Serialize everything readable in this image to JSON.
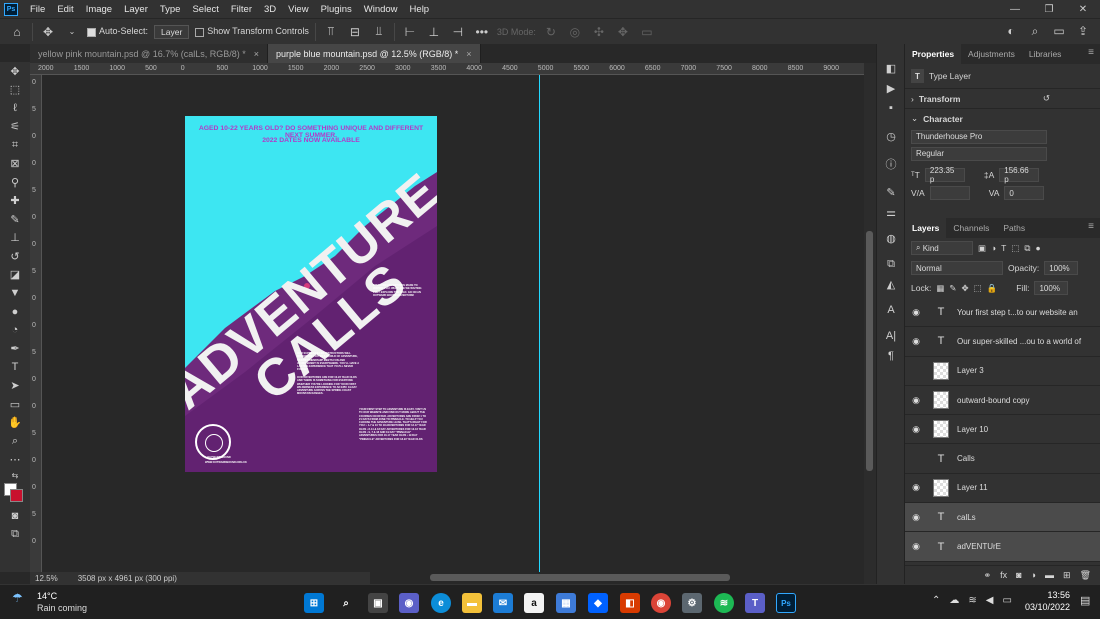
{
  "menubar": {
    "app_icon": "Ps",
    "items": [
      "File",
      "Edit",
      "Image",
      "Layer",
      "Type",
      "Select",
      "Filter",
      "3D",
      "View",
      "Plugins",
      "Window",
      "Help"
    ],
    "window_controls": [
      "—",
      "❐",
      "✕"
    ]
  },
  "options": {
    "auto_select_label": "Auto-Select:",
    "auto_select_value": "Layer",
    "transform_label": "Show Transform Controls",
    "more": "•••",
    "mode_label": "3D Mode:"
  },
  "tabs": [
    {
      "label": "yellow pink mountain.psd @ 16.7% (calLs, RGB/8) *",
      "close": "×"
    },
    {
      "label": "purple blue mountain.psd @ 12.5% (RGB/8) *",
      "close": "×"
    }
  ],
  "ruler": {
    "ticks": [
      "2000",
      "1500",
      "1000",
      "500",
      "0",
      "500",
      "1000",
      "1500",
      "2000",
      "2500",
      "3000",
      "3500",
      "4000",
      "4500",
      "5000",
      "5500",
      "6000",
      "6500",
      "7000",
      "7500",
      "8000",
      "8500",
      "9000"
    ],
    "left_ticks": [
      "0",
      "5",
      "0",
      "0",
      "5",
      "0",
      "0",
      "5",
      "0",
      "0",
      "5",
      "0",
      "0",
      "5",
      "0",
      "0",
      "5",
      "0"
    ]
  },
  "poster": {
    "line1": "AGED 10-22 YEARS OLD? DO SOMETHING UNIQUE AND DIFFERENT NEXT SUMMER.",
    "line2": "2022 DATES NOW AVAILABLE",
    "big1": "ADVENTURE",
    "big2": "CALLS",
    "para1": "DISCOVER ADVENTURES MADE TO INSPIRE YOU. WHAT ARE WE WAITING FOR? EXPLORE THE WILD. GO ON AN OUTWARD BOUND ADVENTURE!",
    "para2": "OUR SUPER-SKILLED INSTRUCTORS WILL INTRODUCE YOU TO A WORLD OF ADVENTURE, WHERE FRIENDSHIP MEETS FUN AND ACHIEVEMENT IS EVERYWHERE. YOU'LL HAVE A LASTING EXPERIENCE THAT YOU'LL NEVER FORGET.",
    "para3": "OUR ADVENTURES ARE FOR 10-22 YEAR OLDS AND THERE IS SOMETHING FOR EVERYONE WHETHER YOU'RE LOOKING FOR YOUR FIRST WILDERNESS EXPERIENCE TO AN EPIC 19-DAY ADVENTURE ACROSS THE SPRING COAST MOUNTAIN RANGES.",
    "para4": "YOUR FIRST STEP TO ADVENTURE IS EASY. VISIT US TO OUR WEBSITE AND FIND OUT MORE ABOUT THE COURSES ON OFFER. ADVENTURES ARE FROM 1 TO 21 DAYS FROM JUNE TO PINNACLE. TO HELP YOU CHOOSE THE ADVENTURE LEVEL THAT'S RIGHT FOR YOU: • 1-7 & 10 TO 18 ADVENTURES FOR 13-17 YEAR OLDS • 8-14 & 18 DAY ADVENTURES FOR 13-16 YEAR OLDS • 9, 7 & 18 AND 19 DAY \"PINNACLE\" ADVENTURES FOR 16-17 YEAR OLDS • 19 DAY \"PINNACLE\" ADVENTURES FOR 18-22 YEAR OLDS",
    "seal_text": "OUTWARD BOUND",
    "website": "WWW.OUTWARDBOUND.ORG.UK"
  },
  "status": {
    "zoom": "12.5%",
    "doc": "3508 px x 4961 px (300 ppi)"
  },
  "properties": {
    "tabs": [
      "Properties",
      "Adjustments",
      "Libraries"
    ],
    "kind": "Type Layer",
    "transform": "Transform",
    "character": "Character",
    "font": "Thunderhouse Pro",
    "style": "Regular",
    "size": "223.35 p",
    "leading": "156.66 p",
    "tracking": "0"
  },
  "layers": {
    "tabs": [
      "Layers",
      "Channels",
      "Paths"
    ],
    "kind": "Kind",
    "blend": "Normal",
    "opacity_label": "Opacity:",
    "opacity": "100%",
    "lock_label": "Lock:",
    "fill_label": "Fill:",
    "fill": "100%",
    "items": [
      {
        "name": "Your first step t...to our website an",
        "type": "text",
        "visible": true,
        "selected": false
      },
      {
        "name": "Our super-skilled ...ou to a world of",
        "type": "text",
        "visible": true,
        "selected": false
      },
      {
        "name": "Layer 3",
        "type": "image",
        "visible": false,
        "selected": false
      },
      {
        "name": "outward-bound copy",
        "type": "image",
        "visible": true,
        "selected": false
      },
      {
        "name": "Layer 10",
        "type": "image",
        "visible": true,
        "selected": false
      },
      {
        "name": "Calls",
        "type": "text",
        "visible": false,
        "selected": false
      },
      {
        "name": "Layer 11",
        "type": "image",
        "visible": true,
        "selected": false
      },
      {
        "name": "calLs",
        "type": "text",
        "visible": true,
        "selected": true
      },
      {
        "name": "adVENTUrE",
        "type": "text",
        "visible": true,
        "selected": true
      }
    ]
  },
  "taskbar": {
    "weather_temp": "14°C",
    "weather_desc": "Rain coming",
    "time": "13:56",
    "date": "03/10/2022"
  }
}
